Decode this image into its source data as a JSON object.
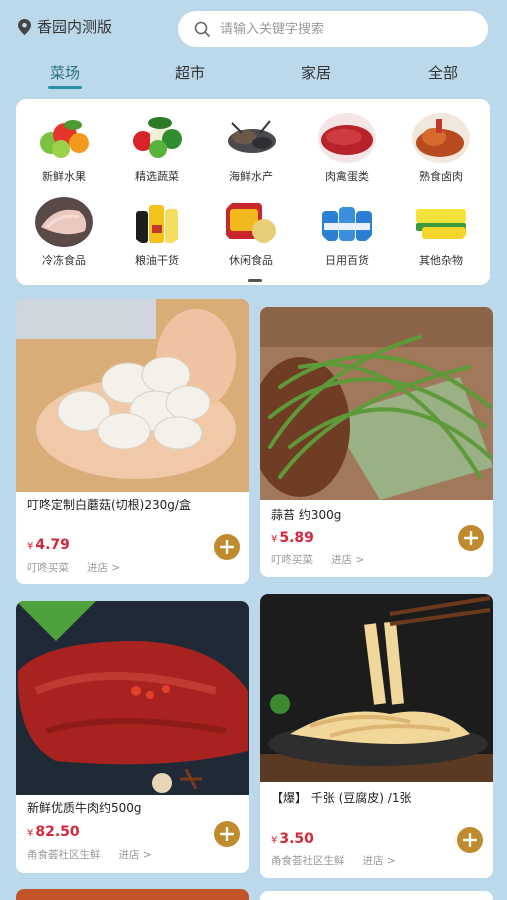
{
  "header": {
    "location": "香园内测版",
    "search_placeholder": "请输入关键字搜索"
  },
  "tabs": [
    "菜场",
    "超市",
    "家居",
    "全部"
  ],
  "categories": [
    {
      "label": "新鲜水果",
      "icon": "fruit-icon"
    },
    {
      "label": "精选蔬菜",
      "icon": "vegetable-icon"
    },
    {
      "label": "海鲜水产",
      "icon": "seafood-icon"
    },
    {
      "label": "肉禽蛋类",
      "icon": "meat-icon"
    },
    {
      "label": "熟食卤肉",
      "icon": "deli-icon"
    },
    {
      "label": "冷冻食品",
      "icon": "frozen-icon"
    },
    {
      "label": "粮油干货",
      "icon": "grain-oil-icon"
    },
    {
      "label": "休闲食品",
      "icon": "snack-icon"
    },
    {
      "label": "日用百货",
      "icon": "daily-goods-icon"
    },
    {
      "label": "其他杂物",
      "icon": "misc-icon"
    }
  ],
  "products": [
    {
      "name": "叮咚定制白蘑菇(切根)230g/盒",
      "currency": "¥",
      "price": "4.79",
      "store": "叮咚买菜",
      "enter": "进店 >"
    },
    {
      "name": "蒜苔 约300g",
      "currency": "¥",
      "price": "5.89",
      "store": "叮咚买菜",
      "enter": "进店 >"
    },
    {
      "name": "新鲜优质牛肉约500g",
      "currency": "¥",
      "price": "82.50",
      "store": "甬食荟社区生鲜",
      "enter": "进店 >"
    },
    {
      "name": "【爆】 千张 (豆腐皮) /1张",
      "currency": "¥",
      "price": "3.50",
      "store": "甬食荟社区生鲜",
      "enter": "进店 >"
    }
  ],
  "colors": {
    "accent": "#2d8fa6",
    "price": "#d8273a",
    "add_button": "#c08a2e",
    "background": "#bcd9ec"
  }
}
